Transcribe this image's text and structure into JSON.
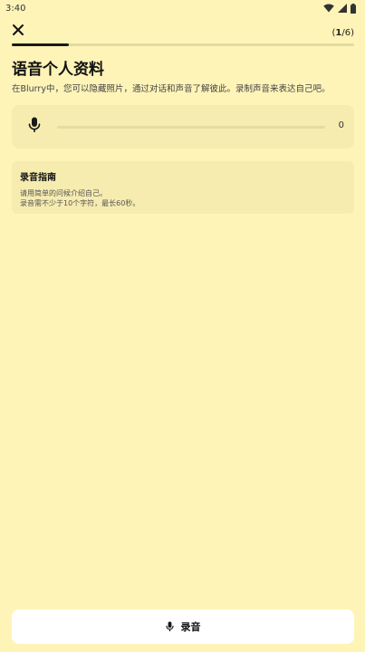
{
  "status_bar": {
    "time": "3:40"
  },
  "header": {
    "step_current": "1",
    "step_total": "6",
    "progress": 0.167
  },
  "page": {
    "title": "语音个人资料",
    "description": "在Blurry中，您可以隐藏照片，通过对话和声音了解彼此。录制声音来表达自己吧。"
  },
  "recorder": {
    "count": "0",
    "level": 0
  },
  "guide": {
    "title": "录音指南",
    "line1": "请用简单的问候介绍自己。",
    "line2": "录音需不少于10个字符，最长60秒。"
  },
  "footer": {
    "record_label": "录音"
  },
  "colors": {
    "background": "#FFF4B8",
    "card": "#F6ECB0",
    "accent": "#1A1A1A",
    "button": "#FFFFFF"
  },
  "icons": {
    "close": "close-icon",
    "mic": "microphone-icon",
    "wifi": "wifi-icon",
    "signal": "signal-icon",
    "battery": "battery-icon"
  }
}
